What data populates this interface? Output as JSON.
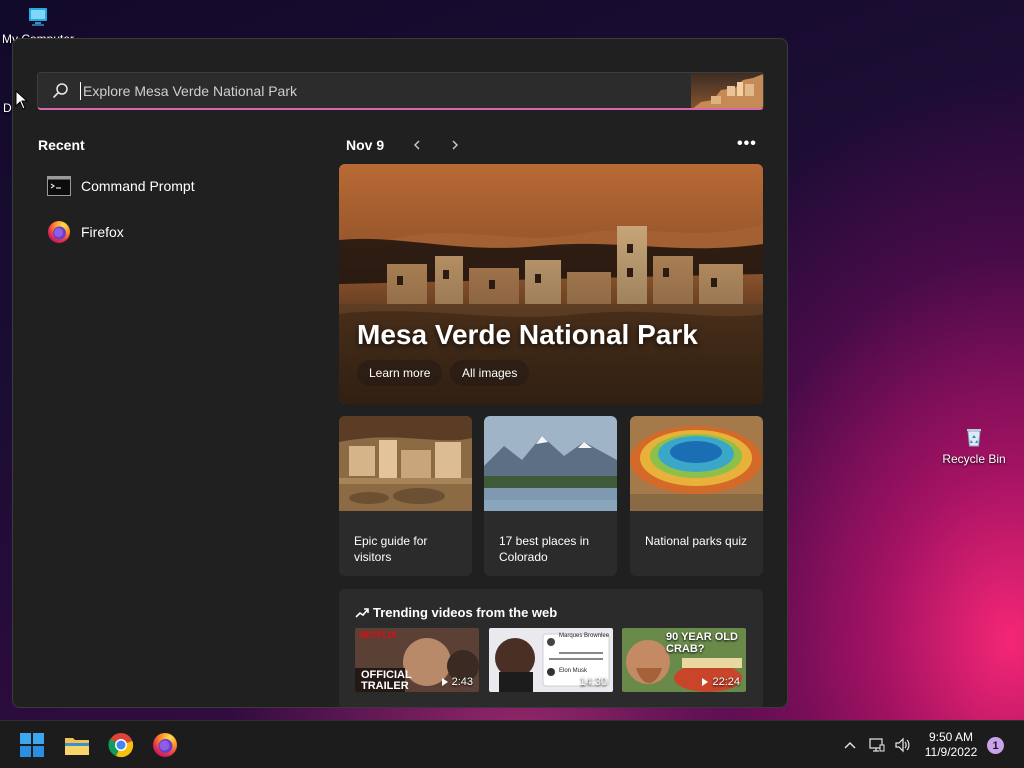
{
  "desktop": {
    "icons": [
      {
        "label": "My Computer",
        "icon": "computer-icon"
      },
      {
        "label": "Recycle Bin",
        "icon": "recycle-bin-icon"
      }
    ],
    "partial_label": "Da"
  },
  "search_panel": {
    "search": {
      "placeholder": "Explore Mesa Verde National Park",
      "value": ""
    },
    "recent": {
      "title": "Recent",
      "items": [
        {
          "label": "Command Prompt",
          "icon": "command-prompt-icon"
        },
        {
          "label": "Firefox",
          "icon": "firefox-icon"
        }
      ]
    },
    "date": {
      "label": "Nov 9",
      "more": "•••"
    },
    "hero": {
      "title": "Mesa Verde National Park",
      "learn_more": "Learn more",
      "all_images": "All images"
    },
    "cards": [
      {
        "caption": "Epic guide for visitors"
      },
      {
        "caption": "17 best places in Colorado"
      },
      {
        "caption": "National parks quiz"
      }
    ],
    "trending": {
      "title": "Trending videos from the web",
      "videos": [
        {
          "duration": "2:43",
          "overlay": "NETFLIX",
          "overlay2": "OFFICIAL TRAILER"
        },
        {
          "duration": "14:30",
          "overlay": "Marques Brownlee",
          "overlay2": "Elon Musk"
        },
        {
          "duration": "22:24",
          "overlay": "90 YEAR OLD CRAB?",
          "overlay2": ""
        }
      ]
    }
  },
  "taskbar": {
    "apps": [
      "start-icon",
      "file-explorer-icon",
      "chrome-icon",
      "firefox-icon"
    ],
    "tray": [
      "chevron-up-icon",
      "network-icon",
      "volume-icon"
    ],
    "time": "9:50 AM",
    "date": "11/9/2022",
    "notification_count": "1"
  },
  "colors": {
    "accent_pink": "#d56ab0",
    "panel_bg": "#202020",
    "card_bg": "#2b2b2b",
    "taskbar_bg": "#1c1c1c"
  }
}
